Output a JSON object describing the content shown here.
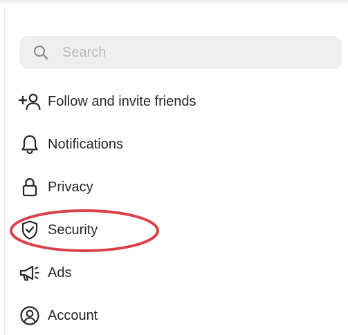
{
  "search": {
    "placeholder": "Search"
  },
  "menu": {
    "items": [
      {
        "label": "Follow and invite friends",
        "icon": "add-person-icon"
      },
      {
        "label": "Notifications",
        "icon": "bell-icon"
      },
      {
        "label": "Privacy",
        "icon": "lock-icon"
      },
      {
        "label": "Security",
        "icon": "shield-check-icon"
      },
      {
        "label": "Ads",
        "icon": "megaphone-icon"
      },
      {
        "label": "Account",
        "icon": "account-circle-icon"
      }
    ]
  },
  "annotation": {
    "highlighted_item": "Security",
    "color": "#d9414a"
  },
  "colors": {
    "text": "#262626",
    "search_background": "#efefef",
    "search_placeholder": "#b9b9b9"
  }
}
